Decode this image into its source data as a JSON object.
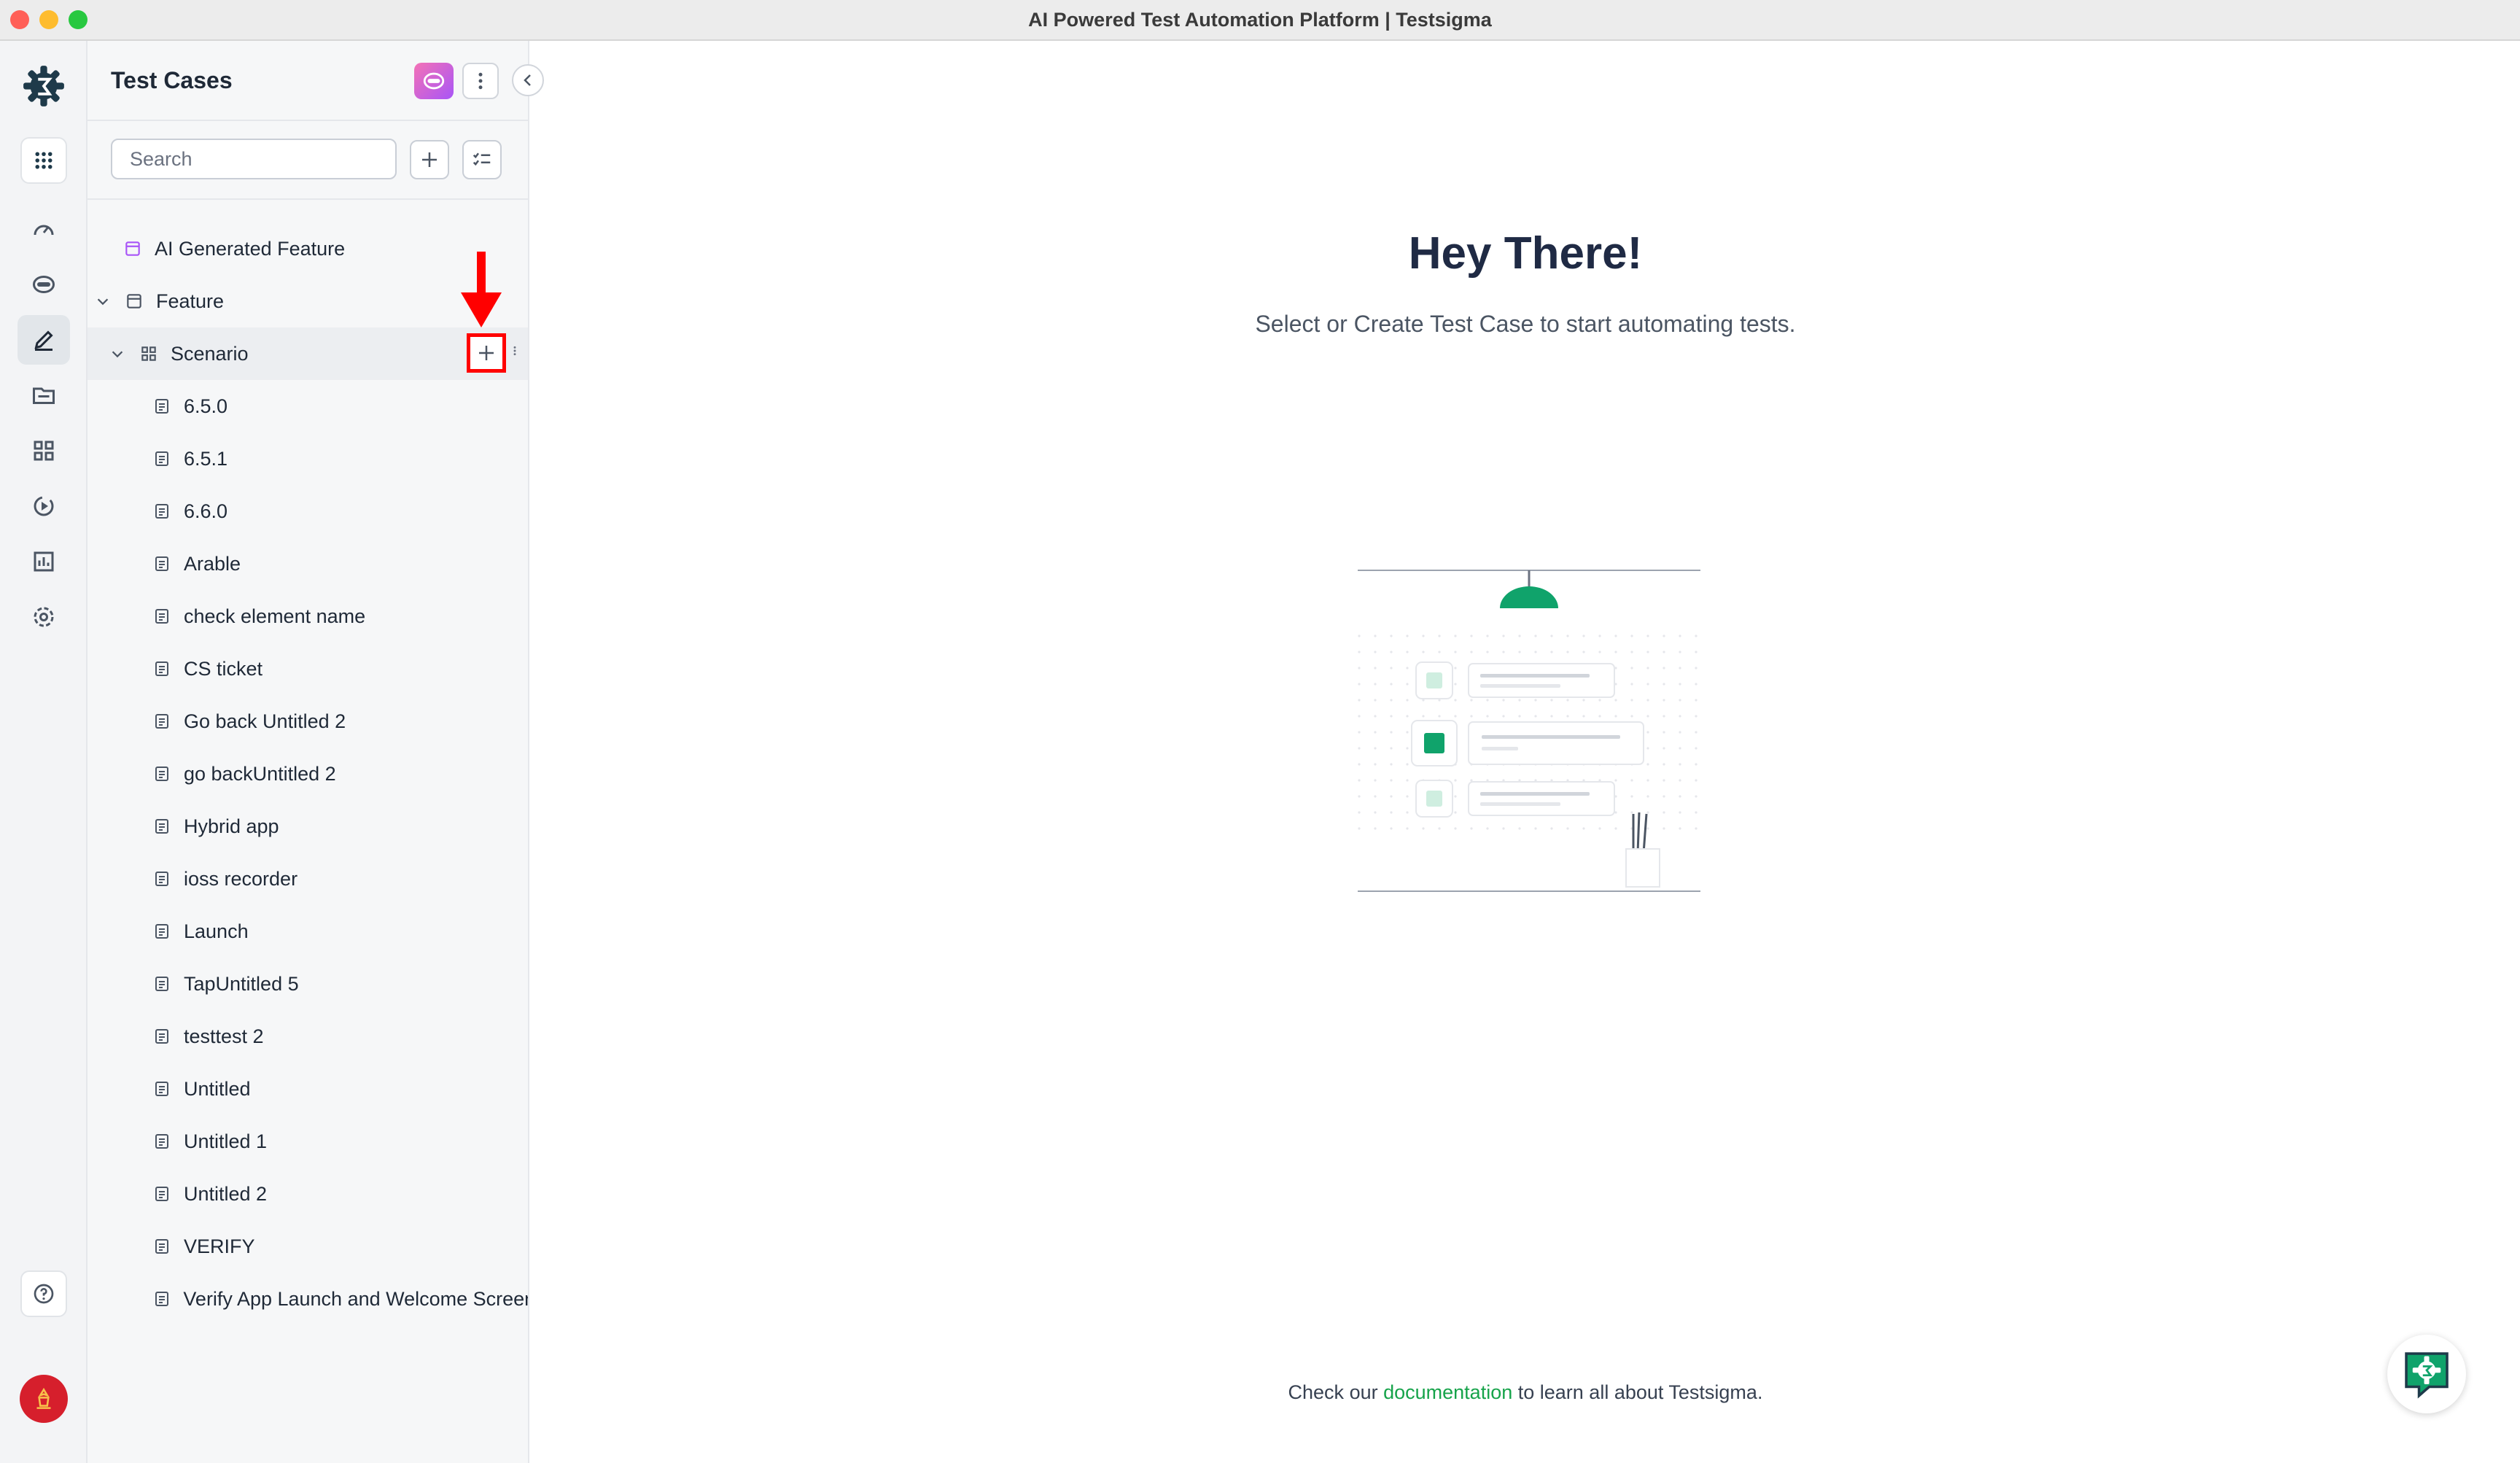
{
  "window": {
    "title": "AI Powered Test Automation Platform | Testsigma"
  },
  "rail": {
    "icons": [
      "testsigma-logo-icon",
      "apps-grid-icon",
      "dashboard-icon",
      "ai-agent-icon",
      "test-cases-icon",
      "test-data-icon",
      "elements-icon",
      "runs-icon",
      "reports-icon",
      "settings-icon",
      "help-icon",
      "avatar-icon"
    ],
    "active": "test-cases-icon"
  },
  "panel": {
    "title": "Test Cases",
    "search_placeholder": "Search",
    "tree": {
      "ai_feature": "AI Generated Feature",
      "feature": "Feature",
      "scenario": "Scenario",
      "test_cases": [
        "6.5.0",
        "6.5.1",
        "6.6.0",
        "Arable",
        "check element name",
        "CS ticket",
        "Go back Untitled 2",
        "go backUntitled 2",
        "Hybrid app",
        "ioss recorder",
        "Launch",
        "TapUntitled 5",
        "testtest 2",
        "Untitled",
        "Untitled 1",
        "Untitled 2",
        "VERIFY",
        "Verify App Launch and Welcome Screen"
      ]
    }
  },
  "main": {
    "heading": "Hey There!",
    "subheading": "Select or Create Test Case to start automating tests.",
    "footer": {
      "prefix": "Check our",
      "link": "documentation",
      "suffix": "to learn all about Testsigma."
    }
  },
  "colors": {
    "brand_dark": "#1e3a4a",
    "accent_green": "#16a34a",
    "highlight_red": "#ff0000"
  }
}
